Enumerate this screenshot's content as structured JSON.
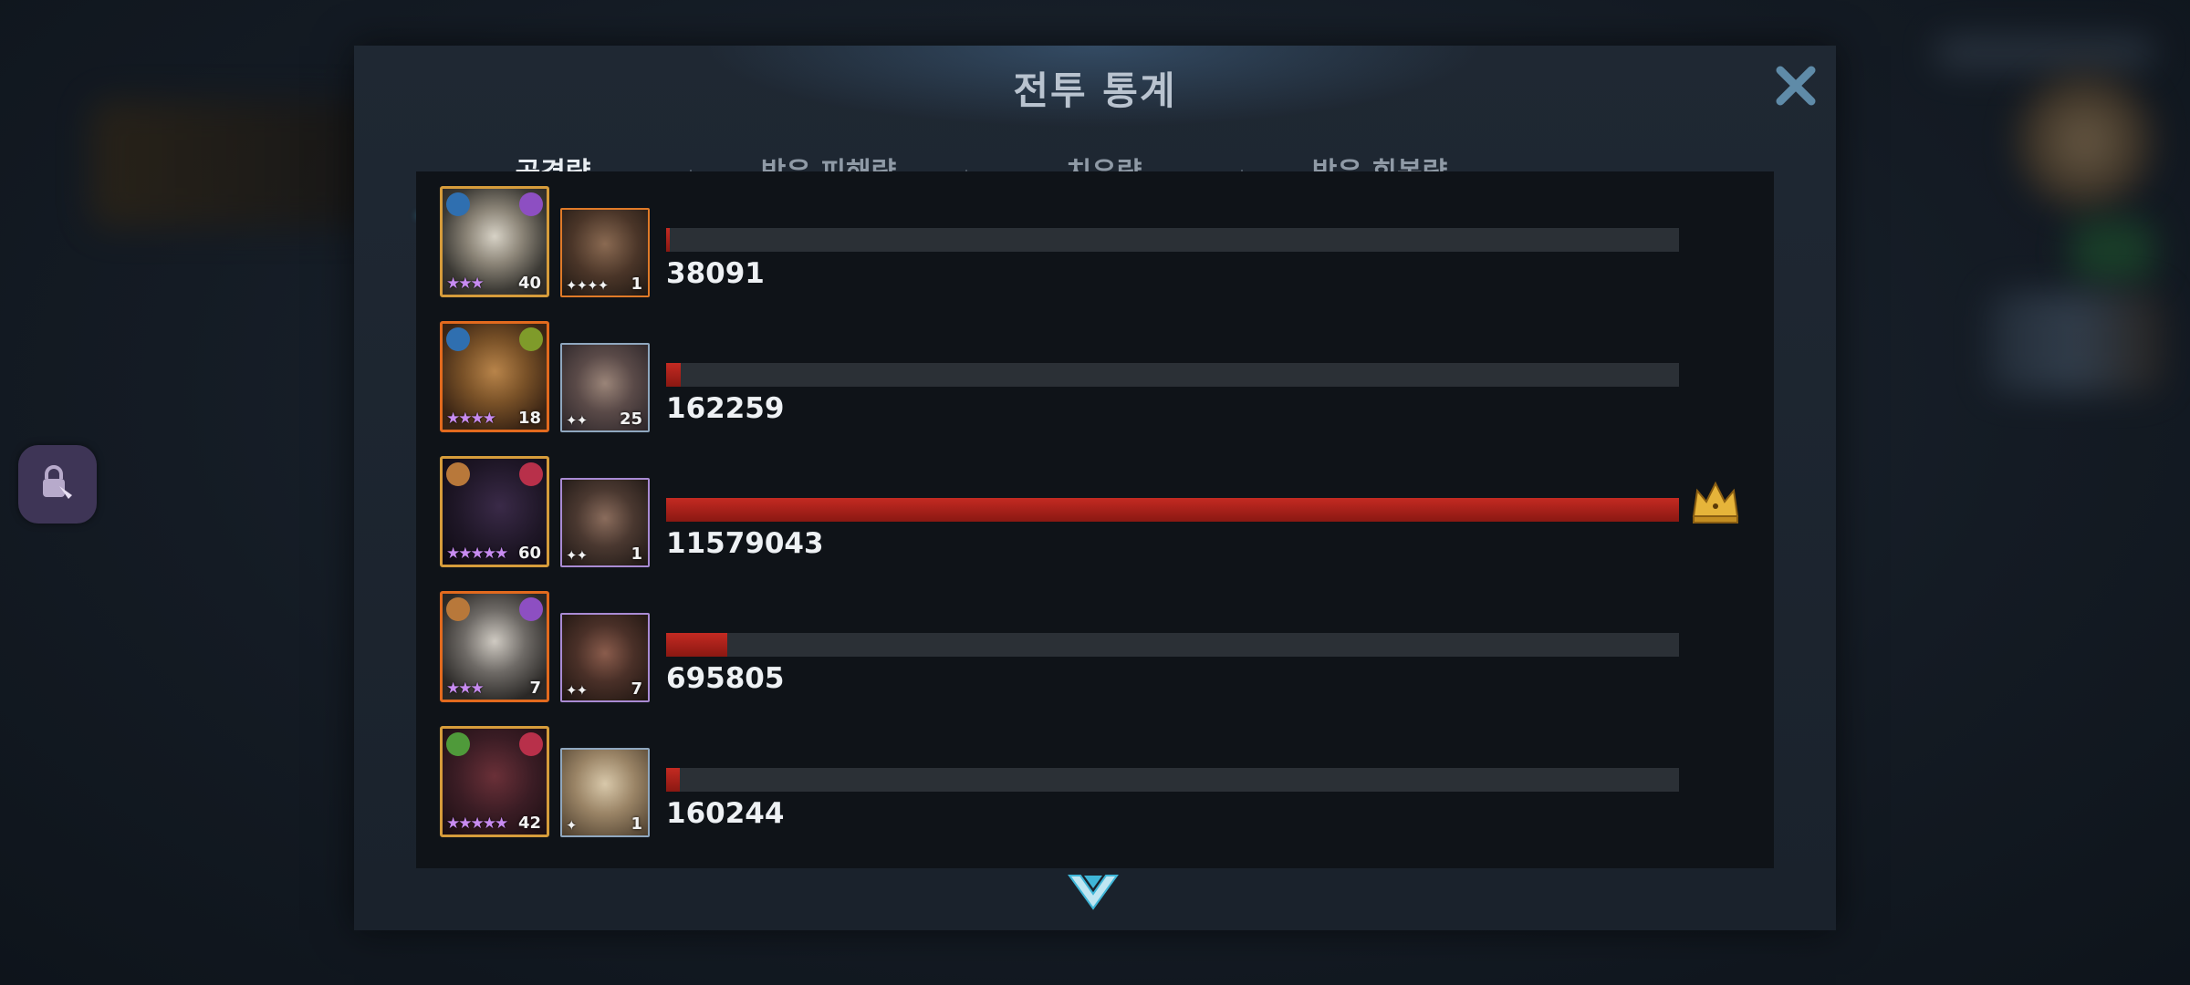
{
  "window": {
    "title": "전투 통계",
    "close_icon": "close-icon"
  },
  "tabs": [
    {
      "label": "공격량",
      "active": true
    },
    {
      "label": "받은 피해량",
      "active": false
    },
    {
      "label": "치유량",
      "active": false
    },
    {
      "label": "받은 회복량",
      "active": false
    }
  ],
  "rows": [
    {
      "hero_level": "40",
      "hero_stars": "★★★",
      "partner_level": "1",
      "partner_stars": "✦✦✦✦",
      "value": "38091",
      "fraction": 0.0033,
      "top": false
    },
    {
      "hero_level": "18",
      "hero_stars": "★★★★",
      "partner_level": "25",
      "partner_stars": "✦✦",
      "value": "162259",
      "fraction": 0.014,
      "top": false
    },
    {
      "hero_level": "60",
      "hero_stars": "★★★★★",
      "partner_level": "1",
      "partner_stars": "✦✦",
      "value": "11579043",
      "fraction": 1.0,
      "top": true
    },
    {
      "hero_level": "7",
      "hero_stars": "★★★",
      "partner_level": "7",
      "partner_stars": "✦✦",
      "value": "695805",
      "fraction": 0.06,
      "top": false
    },
    {
      "hero_level": "42",
      "hero_stars": "★★★★★",
      "partner_level": "1",
      "partner_stars": "✦",
      "value": "160244",
      "fraction": 0.0138,
      "top": false
    }
  ],
  "icons": {
    "crown": "crown-icon",
    "scroll_down": "chevron-down-icon",
    "side_button": "lock-icon"
  },
  "colors": {
    "bar": "#b8221c",
    "tab_active": "#3fb6d8",
    "crown": "#e6b43a"
  }
}
